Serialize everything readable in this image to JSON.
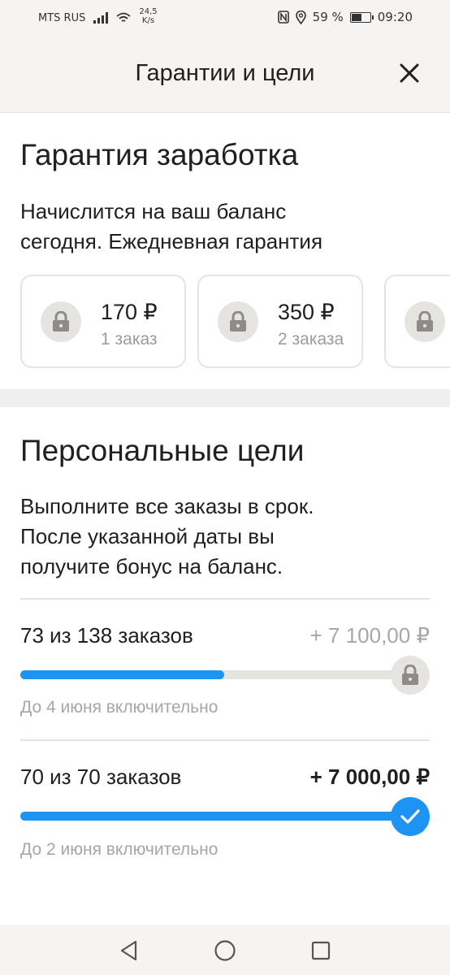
{
  "status_bar": {
    "carrier": "MTS RUS",
    "speed_value": "24,5",
    "speed_unit": "K/s",
    "battery": "59 %",
    "battery_level": 0.59,
    "time": "09:20",
    "icons": [
      "signal-icon",
      "wifi-icon",
      "nfc-icon",
      "location-icon",
      "battery-icon"
    ]
  },
  "header": {
    "title": "Гарантии и цели",
    "close_icon": "close-icon"
  },
  "guarantee": {
    "title": "Гарантия заработка",
    "description_line1": "Начислится на ваш баланс",
    "description_line2": "сегодня. Ежедневная гарантия",
    "cards": [
      {
        "amount": "170 ₽",
        "orders": "1 заказ",
        "icon": "lock-icon"
      },
      {
        "amount": "350 ₽",
        "orders": "2 заказа",
        "icon": "lock-icon"
      }
    ]
  },
  "goals": {
    "title": "Персональные цели",
    "description_line1": "Выполните все заказы в срок.",
    "description_line2": "После указанной даты вы",
    "description_line3": "получите бонус на баланс.",
    "items": [
      {
        "count": "73 из 138 заказов",
        "bonus": "+ 7 100,00 ₽",
        "progress": 0.529,
        "deadline": "До 4 июня включительно",
        "status_icon": "lock-icon",
        "completed": false
      },
      {
        "count": "70 из 70 заказов",
        "bonus": "+ 7 000,00 ₽",
        "progress": 1.0,
        "deadline": "До 2 июня включительно",
        "status_icon": "checkmark-icon",
        "completed": true
      }
    ]
  },
  "colors": {
    "accent": "#1d93f3",
    "background_header": "#f5f4f2",
    "card_border": "#e6e4e1",
    "muted_text": "#a9a6a3"
  },
  "nav_bar": {
    "icons": [
      "back-triangle-icon",
      "home-circle-icon",
      "recents-square-icon"
    ]
  }
}
